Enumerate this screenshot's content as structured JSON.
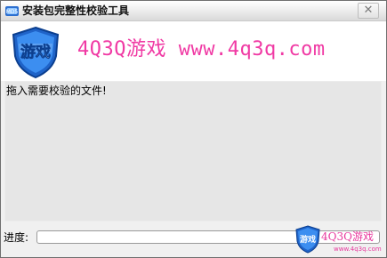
{
  "window": {
    "title": "安装包完整性校验工具",
    "close_label": "✕"
  },
  "banner": {
    "logo_text": "游戏",
    "text": "4Q3Q游戏 www.4q3q.com"
  },
  "main": {
    "instruction": "拖入需要校验的文件!"
  },
  "progress": {
    "label": "进度:",
    "value": 0
  },
  "watermark": {
    "logo_text": "游戏",
    "text": "4Q3Q游戏",
    "url": "www.4q3q.com"
  },
  "colors": {
    "accent_pink": "#f03aa4",
    "shield_blue": "#1f63c8"
  }
}
